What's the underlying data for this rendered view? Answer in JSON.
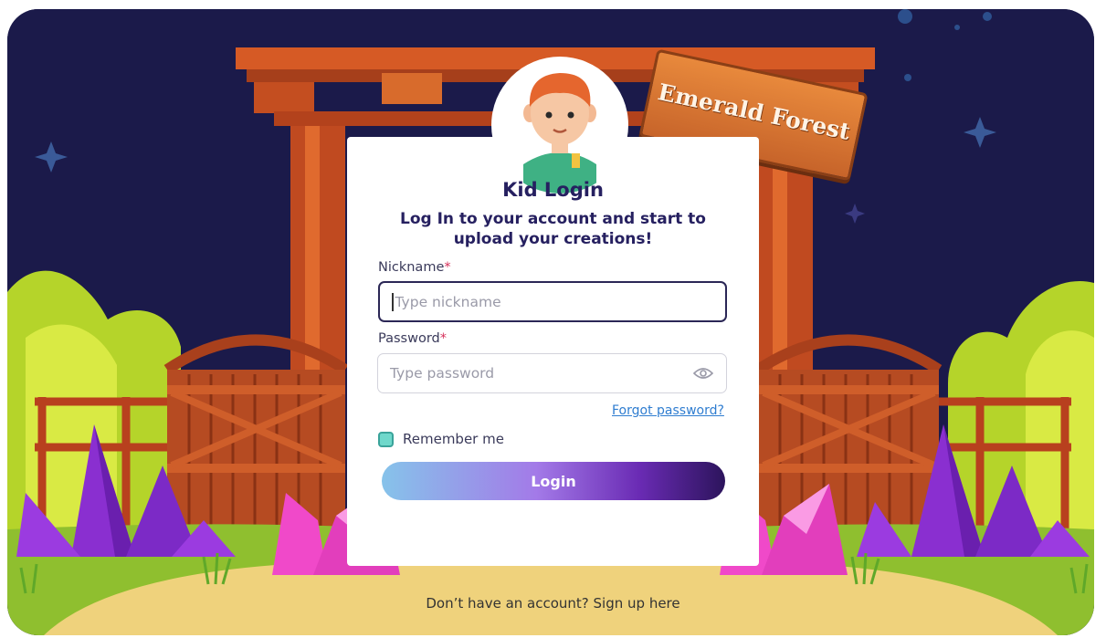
{
  "sign": {
    "text": "Emerald Forest"
  },
  "card": {
    "title": "Kid Login",
    "subtitle": "Log In to your account and start to upload your creations!"
  },
  "form": {
    "nickname_label": "Nickname",
    "required_mark": "*",
    "nickname_placeholder": "Type nickname",
    "password_label": "Password",
    "password_placeholder": "Type password",
    "forgot_link": "Forgot password?",
    "remember_label": "Remember me",
    "login_button": "Login"
  },
  "footer": {
    "signup_text": "Don’t have an account? Sign up here"
  },
  "colors": {
    "night_sky": "#1b1a4a",
    "heading": "#262060",
    "link": "#2f7dd0",
    "checkbox": "#6fd8cb",
    "required": "#d6305a"
  },
  "icons": {
    "password_toggle": "eye-icon"
  }
}
